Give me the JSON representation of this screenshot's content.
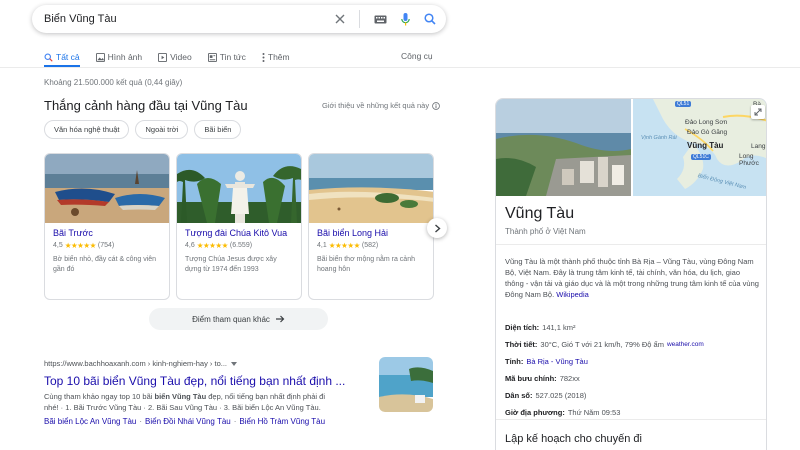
{
  "search": {
    "query": "Biển Vũng Tàu"
  },
  "tabs": [
    {
      "label": "Tất cả",
      "icon": "search-icon"
    },
    {
      "label": "Hình ảnh",
      "icon": "image-icon"
    },
    {
      "label": "Video",
      "icon": "video-icon"
    },
    {
      "label": "Tin tức",
      "icon": "news-icon"
    },
    {
      "label": "Thêm",
      "icon": "more-vert-icon"
    }
  ],
  "tools_label": "Công cụ",
  "result_stats": "Khoảng 21.500.000 kết quả (0,44 giây)",
  "top_sights": {
    "title": "Thắng cảnh hàng đầu tại Vũng Tàu",
    "about": "Giới thiệu về những kết quả này",
    "chips": [
      "Văn hóa nghệ thuật",
      "Ngoài trời",
      "Bãi biển"
    ],
    "cards": [
      {
        "name": "Bãi Trước",
        "rating": "4,5",
        "stars": "★★★★★",
        "reviews": "(754)",
        "desc": "Bờ biển nhỏ, đầy cát & công viên gần đó"
      },
      {
        "name": "Tượng đài Chúa Kitô Vua",
        "rating": "4,6",
        "stars": "★★★★★",
        "reviews": "(6.559)",
        "desc": "Tượng Chúa Jesus được xây dựng từ 1974 đến 1993"
      },
      {
        "name": "Bãi biển Long Hải",
        "rating": "4,1",
        "stars": "★★★★★",
        "reviews": "(582)",
        "desc": "Bãi biển thơ mộng nằm ra cảnh hoang hôn"
      }
    ],
    "more_label": "Điểm tham quan khác"
  },
  "organic": {
    "url": "https://www.bachhoaxanh.com › kinh-nghiem-hay › to...",
    "title": "Top 10 bãi biển Vũng Tàu đẹp, nổi tiếng bạn nhất định ...",
    "snippet_1a": "Cùng tham khảo ngay top 10 bãi ",
    "snippet_1b": "biển Vũng Tàu",
    "snippet_1c": " đẹp, nổi tiếng bạn nhất định phải đi",
    "snippet_2": "nhé! · 1. Bãi Trước Vũng Tàu · 2. Bãi Sau Vũng Tàu · 3. Bãi biển Lộc An Vũng Tàu.",
    "links": [
      "Bãi biển Lộc An Vũng Tàu",
      "Biển Đồi Nhái Vũng Tàu",
      "Biển Hồ Tràm Vũng Tàu"
    ]
  },
  "knowledge_panel": {
    "title": "Vũng Tàu",
    "subtitle": "Thành phố ở Việt Nam",
    "description": "Vũng Tàu là một thành phố thuộc tỉnh Bà Rịa – Vũng Tàu, vùng Đông Nam Bộ, Việt Nam. Đây là trung tâm kinh tế, tài chính, văn hóa, du lịch, giao thông - vận tải và giáo dục và là một trong những trung tâm kinh tế của vùng Đông Nam Bộ.",
    "wiki_link": "Wikipedia",
    "map_labels": {
      "ba_ria": "Bà Rịa",
      "long_son": "Đảo Long Sơn",
      "go_gang": "Đảo Gò Găng",
      "vung_tau": "Vũng Tàu",
      "vinh_ganh_rai": "Vịnh Gành Rái",
      "long_phuoc": "Long Phước",
      "lang": "Lang",
      "bien_dong": "Biển Đông Việt Nam",
      "road_ql51": "QL51",
      "road_ql51c": "QL51C"
    },
    "facts": [
      {
        "label": "Diện tích:",
        "value": "141,1 km²"
      },
      {
        "label": "Thời tiết:",
        "value": "30°C, Gió T với 21 km/h, 79% Độ ẩm",
        "source": "weather.com"
      },
      {
        "label": "Tỉnh:",
        "link": "Bà Rịa - Vũng Tàu"
      },
      {
        "label": "Mã bưu chính:",
        "value": "782xx"
      },
      {
        "label": "Dân số:",
        "value": "527.025 (2018)"
      },
      {
        "label": "Giờ địa phương:",
        "value": "Thứ Năm 09:53"
      }
    ],
    "plan_title": "Lập kế hoạch cho chuyến đi"
  }
}
